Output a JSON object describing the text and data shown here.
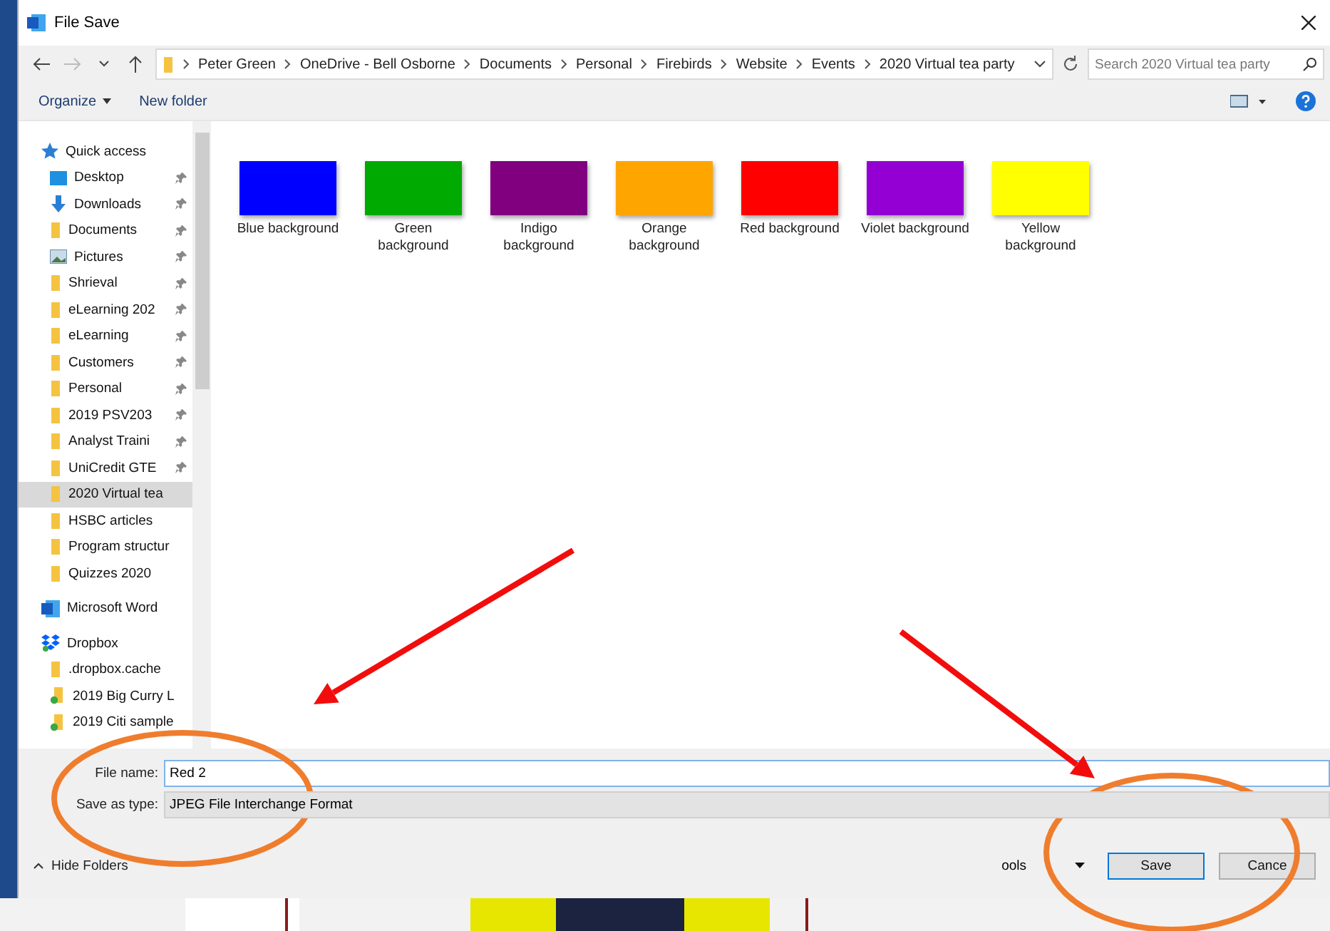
{
  "window": {
    "title": "File Save"
  },
  "navigation": {
    "path": [
      "Peter Green",
      "OneDrive - Bell Osborne",
      "Documents",
      "Personal",
      "Firebirds",
      "Website",
      "Events",
      "2020 Virtual tea party"
    ],
    "search": {
      "placeholder": "Search 2020 Virtual tea party"
    }
  },
  "toolbar": {
    "organize": "Organize",
    "new_folder": "New folder"
  },
  "sidebar": {
    "items": [
      {
        "label": "Quick access",
        "kind": "star",
        "selected": false,
        "children": [
          {
            "label": "Desktop",
            "kind": "desktop",
            "pinned": true,
            "selected": false
          },
          {
            "label": "Downloads",
            "kind": "download",
            "pinned": true,
            "selected": false
          },
          {
            "label": "Documents",
            "kind": "folder",
            "pinned": true,
            "selected": false
          },
          {
            "label": "Pictures",
            "kind": "pictures",
            "pinned": true,
            "selected": false
          },
          {
            "label": "Shrieval",
            "kind": "folder",
            "pinned": true,
            "selected": false
          },
          {
            "label": "eLearning 202",
            "kind": "folder",
            "pinned": true,
            "selected": false
          },
          {
            "label": "eLearning",
            "kind": "folder",
            "pinned": true,
            "selected": false
          },
          {
            "label": "Customers",
            "kind": "folder",
            "pinned": true,
            "selected": false
          },
          {
            "label": "Personal",
            "kind": "folder",
            "pinned": true,
            "selected": false
          },
          {
            "label": "2019 PSV203",
            "kind": "folder",
            "pinned": true,
            "selected": false
          },
          {
            "label": "Analyst Traini",
            "kind": "folder",
            "pinned": true,
            "selected": false
          },
          {
            "label": "UniCredit GTE",
            "kind": "folder",
            "pinned": true,
            "selected": false
          },
          {
            "label": "2020 Virtual tea",
            "kind": "folder",
            "pinned": false,
            "selected": true
          },
          {
            "label": "HSBC articles",
            "kind": "folder",
            "pinned": false,
            "selected": false
          },
          {
            "label": "Program structur",
            "kind": "folder",
            "pinned": false,
            "selected": false
          },
          {
            "label": "Quizzes 2020",
            "kind": "folder",
            "pinned": false,
            "selected": false
          }
        ]
      },
      {
        "label": "Microsoft Word",
        "kind": "word",
        "selected": false
      },
      {
        "label": "Dropbox",
        "kind": "dropbox",
        "selected": false,
        "children": [
          {
            "label": ".dropbox.cache",
            "kind": "folder",
            "synced": false,
            "selected": false
          },
          {
            "label": "2019 Big Curry L",
            "kind": "folder",
            "synced": true,
            "selected": false
          },
          {
            "label": "2019 Citi sample",
            "kind": "folder",
            "synced": true,
            "selected": false
          }
        ]
      }
    ]
  },
  "files": [
    {
      "name": "Blue background",
      "color": "#0000ff"
    },
    {
      "name": "Green background",
      "color": "#00aa00"
    },
    {
      "name": "Indigo background",
      "color": "#800080"
    },
    {
      "name": "Orange background",
      "color": "#ffa500"
    },
    {
      "name": "Red background",
      "color": "#ff0000"
    },
    {
      "name": "Violet background",
      "color": "#9400d3"
    },
    {
      "name": "Yellow background",
      "color": "#ffff00"
    }
  ],
  "form": {
    "file_name_label": "File name:",
    "file_name": "Red 2",
    "type_label": "Save as type:",
    "type": "JPEG File Interchange Format"
  },
  "footer": {
    "hide_folders": "Hide Folders",
    "tools": "ools",
    "save": "Save",
    "cancel": "Cance"
  },
  "annotations": [
    {
      "kind": "arrow"
    },
    {
      "kind": "ellipse"
    },
    {
      "kind": "arrow"
    },
    {
      "kind": "ellipse"
    }
  ]
}
